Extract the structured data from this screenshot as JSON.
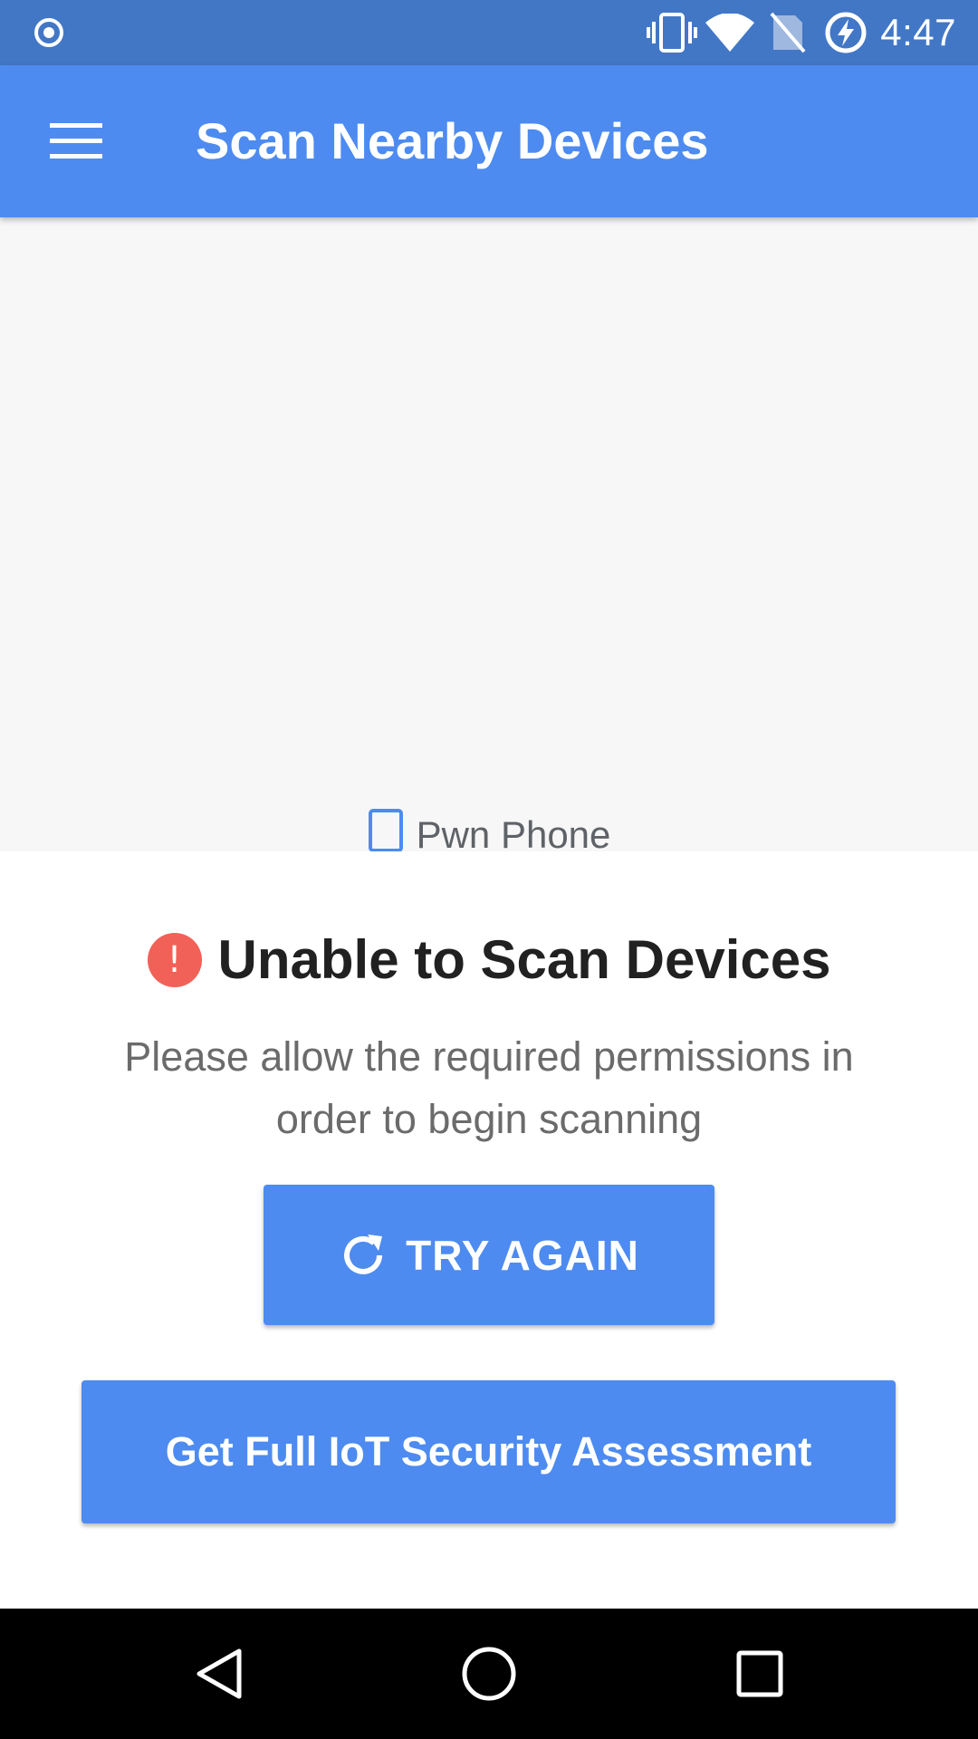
{
  "status_bar": {
    "time": "4:47",
    "left_icon": "record-indicator-icon",
    "icons": [
      "vibrate-icon",
      "wifi-icon",
      "no-sim-icon",
      "battery-charging-icon"
    ]
  },
  "app_bar": {
    "title": "Scan Nearby Devices",
    "menu_icon": "hamburger-menu-icon"
  },
  "scan_area": {
    "devices": [
      {
        "label": "Pwn Phone",
        "icon": "phone-outline-icon"
      }
    ]
  },
  "error": {
    "icon_glyph": "!",
    "title": "Unable to Scan Devices",
    "message": "Please allow the required permissions in order to begin scanning"
  },
  "buttons": {
    "try_again": "TRY AGAIN",
    "assessment": "Get Full IoT Security Assessment"
  },
  "nav_bar": {
    "icons": [
      "back-icon",
      "home-icon",
      "recents-icon"
    ]
  },
  "colors": {
    "status_bar": "#4277c6",
    "accent": "#4d8bf0",
    "error": "#f26157",
    "scan_background": "#f7f7f7"
  }
}
